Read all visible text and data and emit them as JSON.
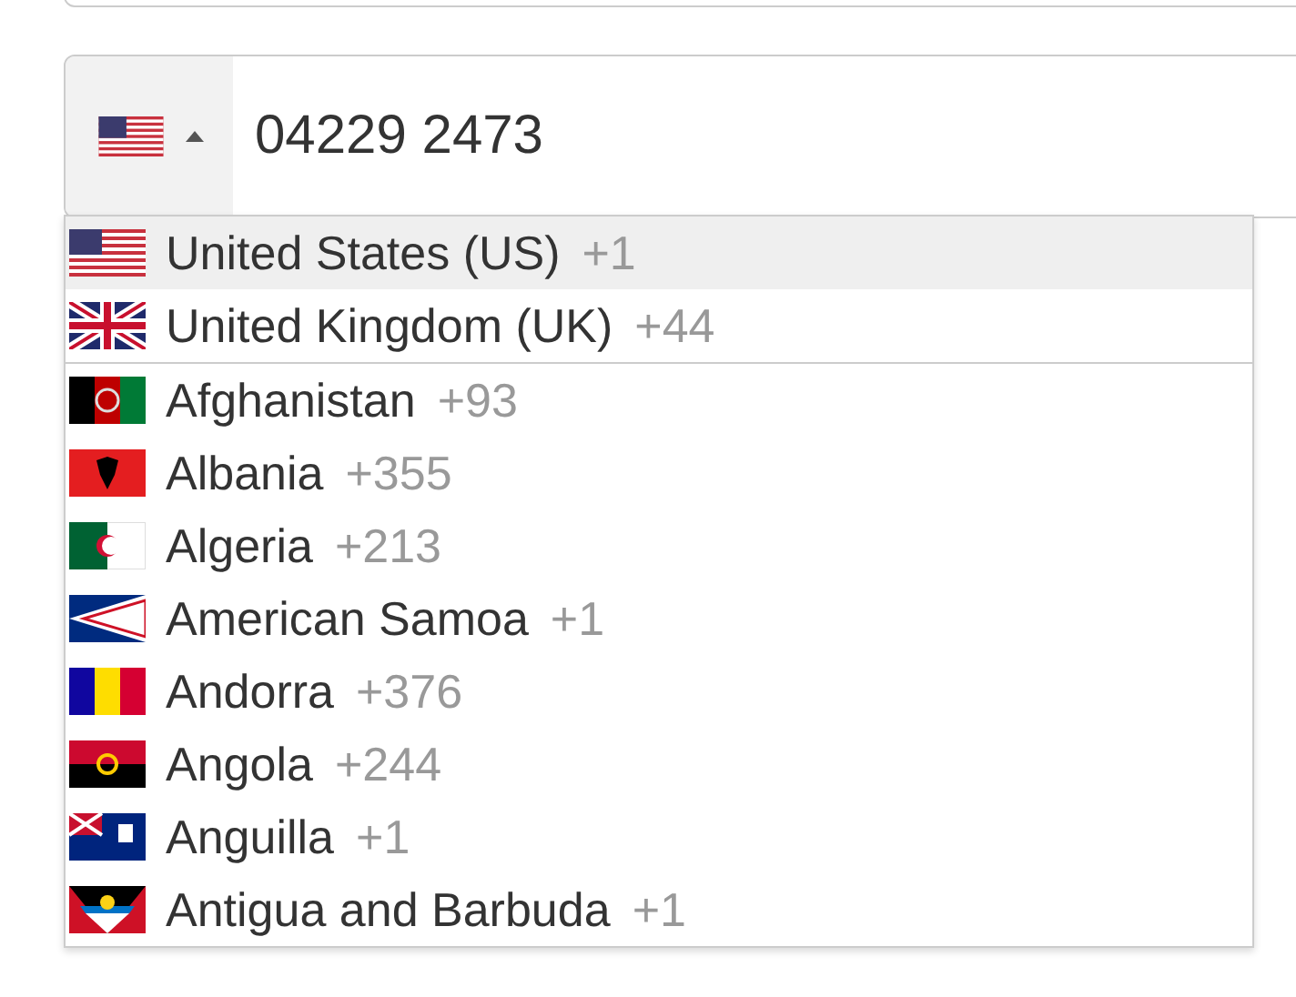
{
  "phone_field": {
    "value": "04229 2473",
    "expanded": true
  },
  "dropdown": {
    "preferred": [
      {
        "country": "United States (US)",
        "code": "+1",
        "selected": true
      },
      {
        "country": "United Kingdom (UK)",
        "code": "+44",
        "selected": false
      }
    ],
    "countries": [
      {
        "country": "Afghanistan",
        "code": "+93",
        "selected": false
      },
      {
        "country": "Albania",
        "code": "+355",
        "selected": false
      },
      {
        "country": "Algeria",
        "code": "+213",
        "selected": false
      },
      {
        "country": "American Samoa",
        "code": "+1",
        "selected": false
      },
      {
        "country": "Andorra",
        "code": "+376",
        "selected": false
      },
      {
        "country": "Angola",
        "code": "+244",
        "selected": false
      },
      {
        "country": "Anguilla",
        "code": "+1",
        "selected": false
      },
      {
        "country": "Antigua and Barbuda",
        "code": "+1",
        "selected": false
      }
    ]
  }
}
